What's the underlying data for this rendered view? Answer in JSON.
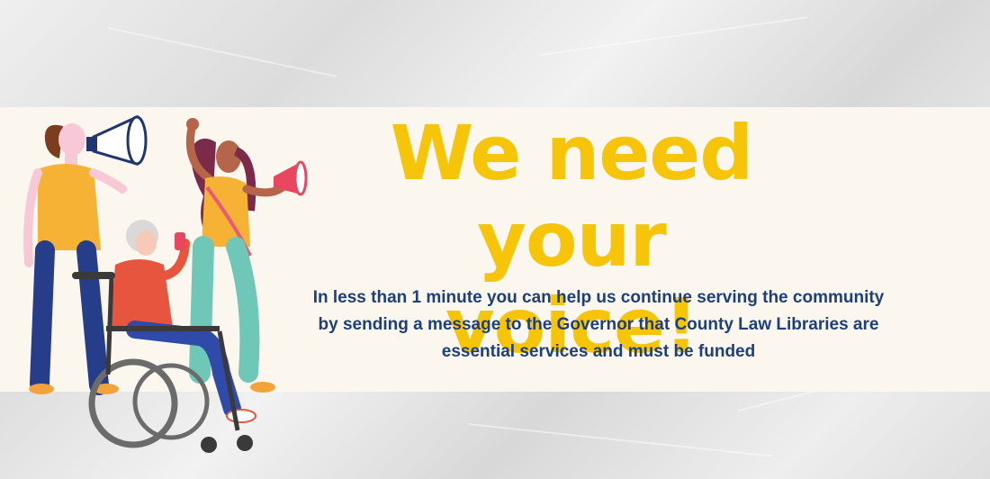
{
  "headline": {
    "line1": "We need",
    "line2": "your voice!"
  },
  "message": {
    "line1": "In less than 1 minute you can help us continue serving the community",
    "line2": "by sending a message to the Governor that County Law Libraries are",
    "line3": "essential services and must be funded"
  },
  "colors": {
    "headline": "#f6c50a",
    "message": "#1d3f7a",
    "band": "#fbf7ef"
  }
}
